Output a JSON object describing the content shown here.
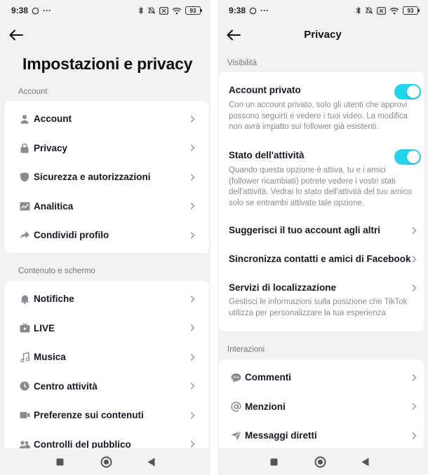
{
  "status_bar": {
    "time": "9:38",
    "ellipsis": "···",
    "battery": "93"
  },
  "left": {
    "title": "Impostazioni e privacy",
    "section_account": "Account",
    "account_items": [
      {
        "label": "Account",
        "icon": "person-icon"
      },
      {
        "label": "Privacy",
        "icon": "lock-icon"
      },
      {
        "label": "Sicurezza e autorizzazioni",
        "icon": "shield-icon"
      },
      {
        "label": "Analitica",
        "icon": "chart-icon"
      },
      {
        "label": "Condividi profilo",
        "icon": "share-icon"
      }
    ],
    "section_content": "Contenuto e schermo",
    "content_items": [
      {
        "label": "Notifiche",
        "icon": "bell-icon"
      },
      {
        "label": "LIVE",
        "icon": "live-tv-icon"
      },
      {
        "label": "Musica",
        "icon": "music-note-icon"
      },
      {
        "label": "Centro attività",
        "icon": "clock-icon"
      },
      {
        "label": "Preferenze sui contenuti",
        "icon": "video-camera-icon"
      },
      {
        "label": "Controlli del pubblico",
        "icon": "people-icon"
      }
    ]
  },
  "right": {
    "title": "Privacy",
    "section_visibility": "Visibilità",
    "private_account": {
      "title": "Account privato",
      "desc": "Con un account privato, solo gli utenti che approvi possono seguirti e vedere i tuoi video. La modifica non avrà impatto sui follower già esistenti.",
      "enabled": true
    },
    "activity_status": {
      "title": "Stato dell'attività",
      "desc": "Quando questa opzione è attiva, tu e i amici (follower ricambiati) potrete vedere i vostri stati dell'attività. Vedrai lo stato dell'attività del tuo amico solo se entrambi attivate tale opzione.",
      "enabled": true
    },
    "suggest_account": "Suggerisci il tuo account agli altri",
    "sync_contacts": "Sincronizza contatti e amici di Facebook",
    "location": {
      "title": "Servizi di localizzazione",
      "desc": "Gestisci le informazioni sulla posizione che TikTok utilizza per personalizzare la tua esperienza"
    },
    "section_interactions": "Interazioni",
    "interaction_items": [
      {
        "label": "Commenti",
        "icon": "comment-icon"
      },
      {
        "label": "Menzioni",
        "icon": "at-sign-icon"
      },
      {
        "label": "Messaggi diretti",
        "icon": "send-icon"
      }
    ]
  },
  "colors": {
    "toggle_on": "#20d5ec",
    "background": "#f2f2f4",
    "card": "#ffffff",
    "text": "#161823",
    "muted": "#8a8b91"
  }
}
